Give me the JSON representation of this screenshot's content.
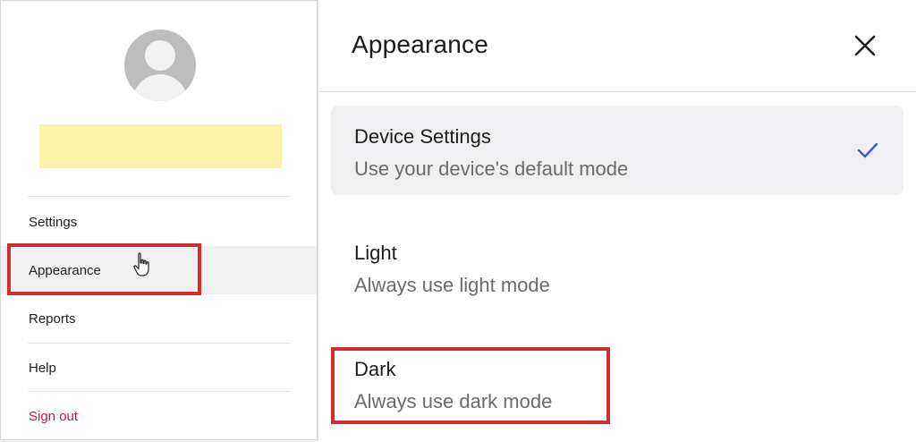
{
  "menu": {
    "items": [
      {
        "label": "Settings"
      },
      {
        "label": "Appearance"
      },
      {
        "label": "Reports"
      },
      {
        "label": "Help"
      },
      {
        "label": "Sign out"
      }
    ]
  },
  "appearance_panel": {
    "title": "Appearance",
    "options": [
      {
        "title": "Device Settings",
        "subtitle": "Use your device's default mode",
        "selected": true
      },
      {
        "title": "Light",
        "subtitle": "Always use light mode",
        "selected": false
      },
      {
        "title": "Dark",
        "subtitle": "Always use dark mode",
        "selected": false
      }
    ]
  },
  "colors": {
    "highlight": "#d12f2f",
    "check": "#3a5fbf",
    "signout": "#b7165a",
    "name_placeholder": "#fbf3a7"
  },
  "icons": {
    "avatar": "user-silhouette",
    "close": "close-icon",
    "check": "check-icon",
    "cursor": "hand-pointer-icon"
  }
}
